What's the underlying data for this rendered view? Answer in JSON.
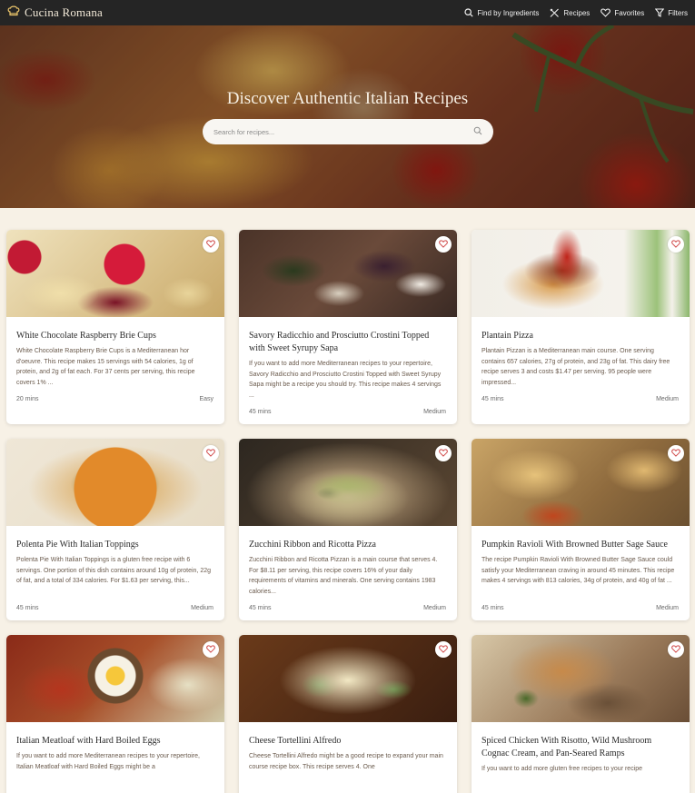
{
  "nav": {
    "brand": "Cucina Romana",
    "links": [
      {
        "label": "Find by Ingredients",
        "icon": "search-icon"
      },
      {
        "label": "Recipes",
        "icon": "utensils-icon"
      },
      {
        "label": "Favorites",
        "icon": "heart-icon"
      },
      {
        "label": "Filters",
        "icon": "filter-icon"
      }
    ]
  },
  "hero": {
    "title": "Discover Authentic Italian Recipes",
    "search_placeholder": "Search for recipes..."
  },
  "recipes": [
    {
      "title": "White Chocolate Raspberry Brie Cups",
      "description": "White Chocolate Raspberry Brie Cups is a Mediterranean hor d'oeuvre. This recipe makes 15 servings with 54 calories, 1g of protein, and 2g of fat each. For 37 cents per serving, this recipe covers 1% ...",
      "time": "20 mins",
      "difficulty": "Easy"
    },
    {
      "title": "Savory Radicchio and Prosciutto Crostini Topped with Sweet Syrupy Sapa",
      "description": "If you want to add more Mediterranean recipes to your repertoire, Savory Radicchio and Prosciutto Crostini Topped with Sweet Syrupy Sapa might be a recipe you should try. This recipe makes 4 servings ...",
      "time": "45 mins",
      "difficulty": "Medium"
    },
    {
      "title": "Plantain Pizza",
      "description": "Plantain Pizzan is a Mediterranean main course. One serving contains 657 calories, 27g of protein, and 23g of fat. This dairy free recipe serves 3 and costs $1.47 per serving. 95 people were impressed...",
      "time": "45 mins",
      "difficulty": "Medium"
    },
    {
      "title": "Polenta Pie With Italian Toppings",
      "description": "Polenta Pie With Italian Toppings is a gluten free recipe with 6 servings. One portion of this dish contains around 10g of protein, 22g of fat, and a total of 334 calories. For $1.63 per serving, this...",
      "time": "45 mins",
      "difficulty": "Medium"
    },
    {
      "title": "Zucchini Ribbon and Ricotta Pizza",
      "description": "Zucchini Ribbon and Ricotta Pizzan is a main course that serves 4. For $8.11 per serving, this recipe covers 16% of your daily requirements of vitamins and minerals. One serving contains 1983 calories...",
      "time": "45 mins",
      "difficulty": "Medium"
    },
    {
      "title": "Pumpkin Ravioli With Browned Butter Sage Sauce",
      "description": "The recipe Pumpkin Ravioli With Browned Butter Sage Sauce could satisfy your Mediterranean craving in around 45 minutes. This recipe makes 4 servings with 813 calories, 34g of protein, and 40g of fat ...",
      "time": "45 mins",
      "difficulty": "Medium"
    },
    {
      "title": "Italian Meatloaf with Hard Boiled Eggs",
      "description": "If you want to add more Mediterranean recipes to your repertoire, Italian Meatloaf with Hard Boiled Eggs might be a",
      "time": "",
      "difficulty": ""
    },
    {
      "title": "Cheese Tortellini Alfredo",
      "description": "Cheese Tortellini Alfredo might be a good recipe to expand your main course recipe box. This recipe serves 4. One",
      "time": "",
      "difficulty": ""
    },
    {
      "title": "Spiced Chicken With Risotto, Wild Mushroom Cognac Cream, and Pan-Seared Ramps",
      "description": "If you want to add more gluten free recipes to your recipe",
      "time": "",
      "difficulty": ""
    }
  ]
}
